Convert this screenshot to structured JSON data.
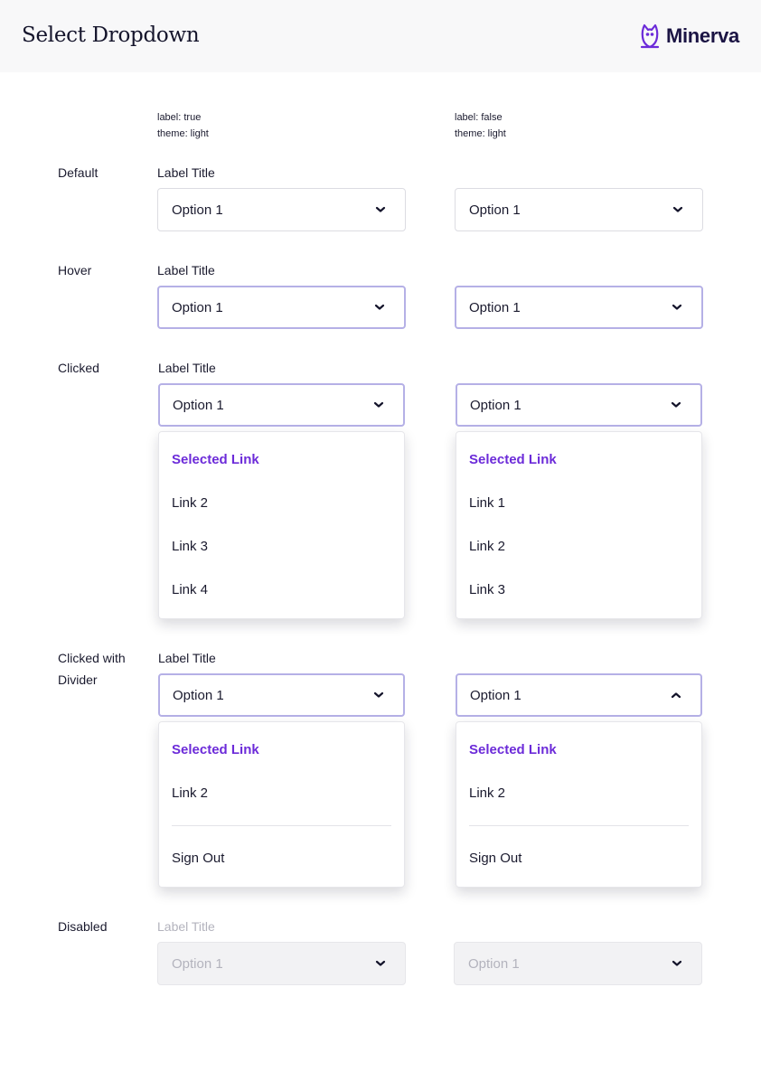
{
  "header": {
    "title": "Select Dropdown",
    "brand": "Minerva"
  },
  "columns": [
    {
      "label_line": "label: true",
      "theme_line": "theme: light"
    },
    {
      "label_line": "label: false",
      "theme_line": "theme: light"
    }
  ],
  "rows": {
    "default": {
      "name": "Default",
      "label": "Label Title",
      "value_left": "Option 1",
      "value_right": "Option 1"
    },
    "hover": {
      "name": "Hover",
      "label": "Label Title",
      "value_left": "Option 1",
      "value_right": "Option 1"
    },
    "clicked": {
      "name": "Clicked",
      "label": "Label Title",
      "value_left": "Option 1",
      "value_right": "Option 1",
      "menu_left": [
        "Selected Link",
        "Link 2",
        "Link 3",
        "Link 4"
      ],
      "menu_right": [
        "Selected Link",
        "Link 1",
        "Link 2",
        "Link 3"
      ]
    },
    "divider": {
      "name_line1": "Clicked with",
      "name_line2": "Divider",
      "label": "Label Title",
      "value_left": "Option 1",
      "value_right": "Option 1",
      "menu_left": [
        "Selected Link",
        "Link 2",
        "Sign Out"
      ],
      "menu_right": [
        "Selected Link",
        "Link 2",
        "Sign Out"
      ]
    },
    "disabled": {
      "name": "Disabled",
      "label": "Label Title",
      "value_left": "Option 1",
      "value_right": "Option 1"
    }
  },
  "colors": {
    "accent": "#6c2bd9",
    "focus_border": "#b5b0e6",
    "brand_text": "#1b1444"
  },
  "icons": {
    "brand": "owl-icon",
    "chevron_down": "chevron-down-icon",
    "chevron_up": "chevron-up-icon"
  }
}
